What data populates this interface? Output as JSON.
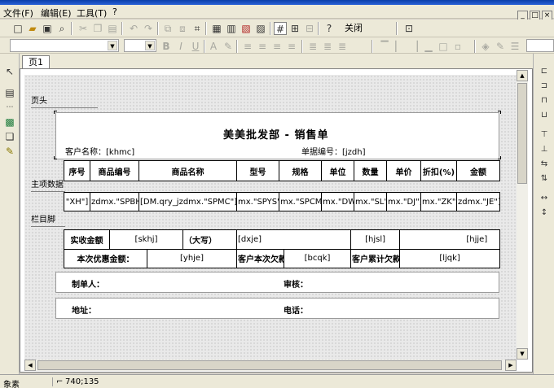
{
  "menu": {
    "file": "文件(F)",
    "edit": "编辑(E)",
    "tools": "工具(T)",
    "help": "?"
  },
  "window_buttons": {
    "min": "_",
    "max": "□",
    "close": "×"
  },
  "toolbar": {
    "close_label": "关闭"
  },
  "tabs": [
    {
      "label": "页1"
    }
  ],
  "bands": {
    "header": "页头",
    "detail": "主项数据",
    "footer": "栏目脚"
  },
  "report": {
    "title": "美美批发部 - 销售单",
    "customer_label": "客户名称：[khmc]",
    "doc_no_label": "单据编号：[jzdh]",
    "columns": [
      "序号",
      "商品编号",
      "商品名称",
      "型号",
      "规格",
      "单位",
      "数量",
      "单价",
      "折扣(%)",
      "金额"
    ],
    "detail_fields": [
      "\"XH\"]",
      "zdmx.\"SPBH\"]",
      "[DM.qry_jzdmx.\"SPMC\"]",
      "mx.\"SPYS\"]",
      "mx.\"SPCM\"]",
      "mx.\"DW\"]",
      "mx.\"SL\"]",
      "mx.\"DJ\"]",
      "mx.\"ZK\"]",
      "zdmx.\"JE\"]"
    ],
    "footer_row1": {
      "label": "实收金额",
      "skhj": "[skhj]",
      "daxie": "（大写）",
      "dxje": "[dxje]",
      "hjsl": "[hjsl]",
      "hjje": "[hjje]"
    },
    "footer_row2": {
      "discount_label": "本次优惠金额：",
      "yhje": "[yhje]",
      "owe_label": "客户本次欠款：",
      "bcqk": "[bcqk]",
      "total_owe_label": "客户累计欠款：",
      "ljqk": "[ljqk]"
    },
    "maker_label": "制单人：",
    "review_label": "审核：",
    "address_label": "地址：",
    "phone_label": "电话："
  },
  "status": {
    "left": "象素",
    "coords": "740;135"
  }
}
